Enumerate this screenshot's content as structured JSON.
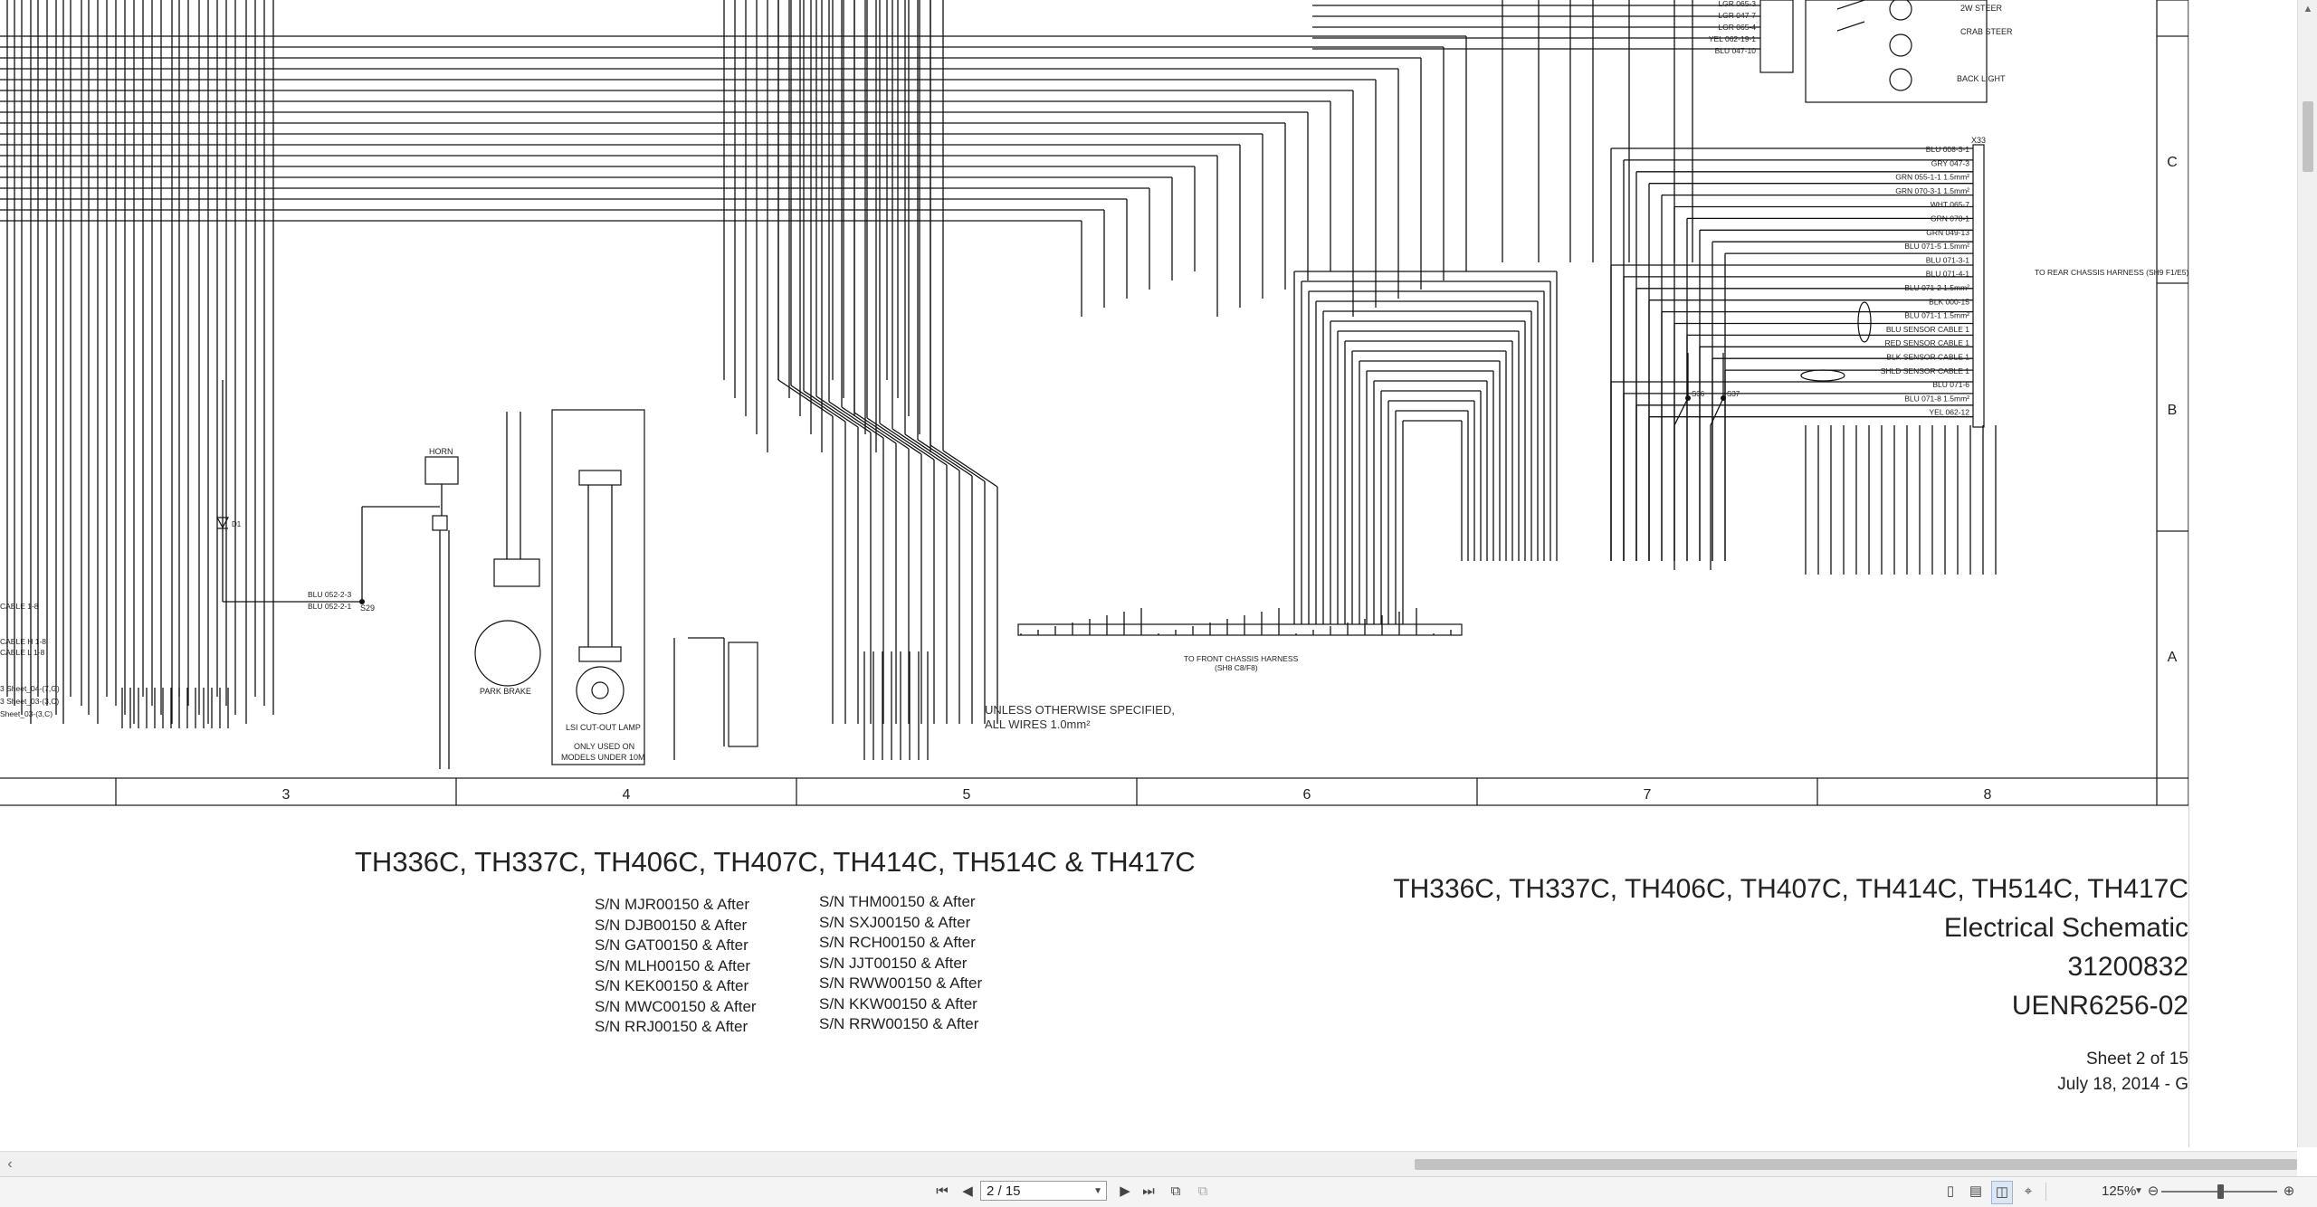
{
  "viewer": {
    "page_indicator": "2 / 15",
    "zoom": "125%"
  },
  "schematic": {
    "column_numbers": [
      "3",
      "4",
      "5",
      "6",
      "7",
      "8"
    ],
    "row_letters": [
      "C",
      "B",
      "A"
    ],
    "labels": {
      "steer_2w": "2W STEER",
      "crab_steer": "CRAB STEER",
      "back_light": "BACK LIGHT",
      "to_rear_chassis": "TO REAR CHASSIS HARNESS (SH9 F1/E5)",
      "to_front_chassis": "TO FRONT CHASSIS HARNESS",
      "to_front_chassis_ref": "(SH8 C8/F8)",
      "horn": "HORN",
      "park_brake": "PARK BRAKE",
      "lsi_lamp": "LSI CUT-OUT LAMP",
      "only_used": "ONLY USED ON",
      "models_under": "MODELS UNDER 10M",
      "connector_x33": "X33",
      "splice_s29": "S29",
      "splice_s36": "S36",
      "splice_s37": "S37",
      "diode_d1": "D1"
    },
    "x33_wires": [
      "BLU 008-3-1",
      "GRY 047-3",
      "GRN 055-1-1 1.5mm²",
      "GRN 070-3-1 1.5mm²",
      "WHT 065-7",
      "GRN 078-1",
      "GRN 049-13",
      "BLU 071-5 1.5mm²",
      "BLU 071-3-1",
      "BLU 071-4-1",
      "BLU 071-2 1.5mm²",
      "BLK 000-15",
      "BLU 071-1 1.5mm²",
      "BLU SENSOR CABLE 1",
      "RED SENSOR CABLE 1",
      "BLK SENSOR CABLE 1",
      "SHLD SENSOR CABLE 1",
      "BLU 071-6",
      "BLU 071-8 1.5mm²",
      "YEL 062-12"
    ],
    "top_wires": [
      "LGR 065-3",
      "LGR 047-7",
      "LGR 065-4",
      "YEL 062-19-1",
      "BLU 047-10"
    ],
    "left_refs": [
      "CABLE 1-8",
      "CABLE H 1-8",
      "CABLE L 1-8",
      "3 Sheet_04-(7,G)",
      "3 Sheet_03-(3,C)",
      "Sheet_03-(3,C)"
    ],
    "mid_wires": [
      "BLU 052-2-3",
      "BLU 052-2-1"
    ],
    "note_line1": "UNLESS OTHERWISE SPECIFIED,",
    "note_line2": "ALL WIRES 1.0mm²"
  },
  "title_left": {
    "models": "TH336C, TH337C, TH406C, TH407C, TH414C, TH514C & TH417C",
    "sn_col1": [
      "S/N MJR00150 & After",
      "S/N DJB00150 & After",
      "S/N GAT00150 & After",
      "S/N MLH00150 & After",
      "S/N KEK00150 & After",
      "S/N MWC00150 & After",
      "S/N RRJ00150 & After"
    ],
    "sn_col2": [
      "S/N THM00150 & After",
      "S/N SXJ00150 & After",
      "S/N RCH00150 & After",
      "S/N JJT00150 & After",
      "S/N RWW00150 & After",
      "S/N KKW00150 & After",
      "S/N RRW00150 & After"
    ]
  },
  "title_right": {
    "models": "TH336C, TH337C, TH406C, TH407C, TH414C, TH514C, TH417C",
    "doc_type": "Electrical Schematic",
    "part_number": "31200832",
    "doc_number": "UENR6256-02",
    "sheet": "Sheet 2 of 15",
    "date": "July 18, 2014 - G"
  }
}
